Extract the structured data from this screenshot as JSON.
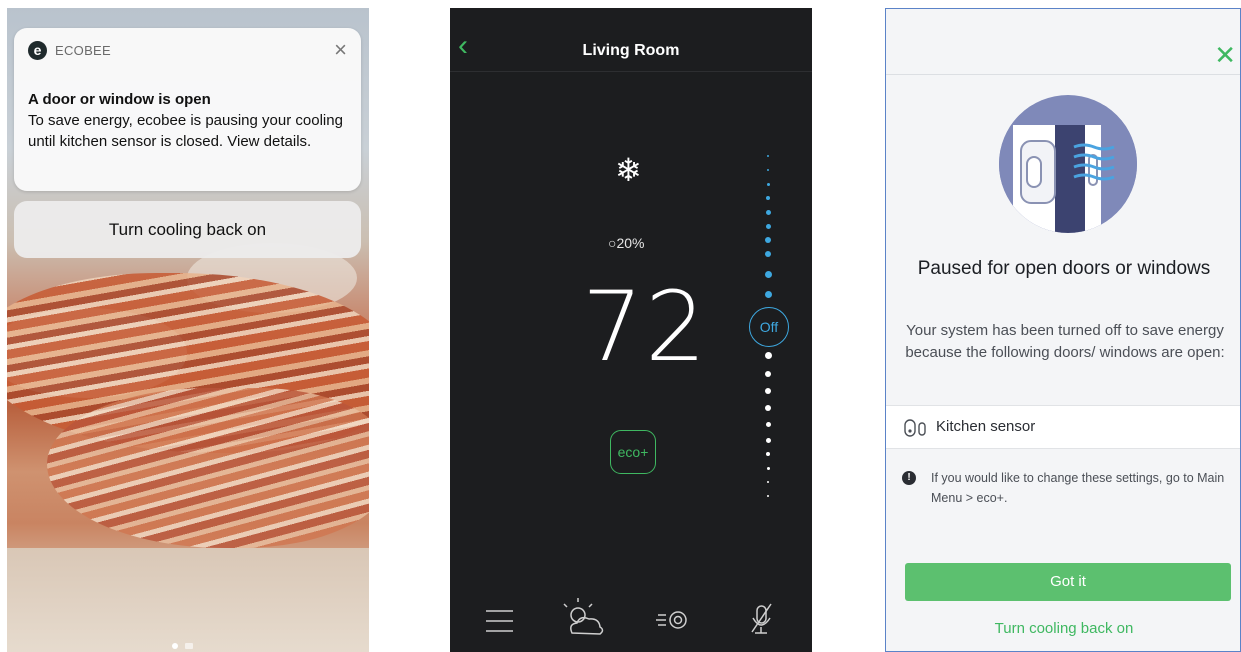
{
  "panel1": {
    "notification": {
      "app_name": "ECOBEE",
      "title": "A door or window is open",
      "body": "To save energy, ecobee is pausing your cooling until kitchen sensor is closed. View details."
    },
    "action_label": "Turn cooling back on"
  },
  "panel2": {
    "room": "Living Room",
    "humidity": "20%",
    "temperature": "72",
    "eco_label": "eco+",
    "mode_label": "Off",
    "colors": {
      "accent_green": "#3fb861",
      "accent_blue": "#3ea8e0"
    }
  },
  "panel3": {
    "heading": "Paused for open doors or windows",
    "description": "Your system has been turned off to save energy because the following doors/ windows are open:",
    "sensor_name": "Kitchen sensor",
    "info": "If you would like to change these settings, go to Main Menu > eco+.",
    "primary_button": "Got it",
    "secondary_link": "Turn cooling back on"
  }
}
